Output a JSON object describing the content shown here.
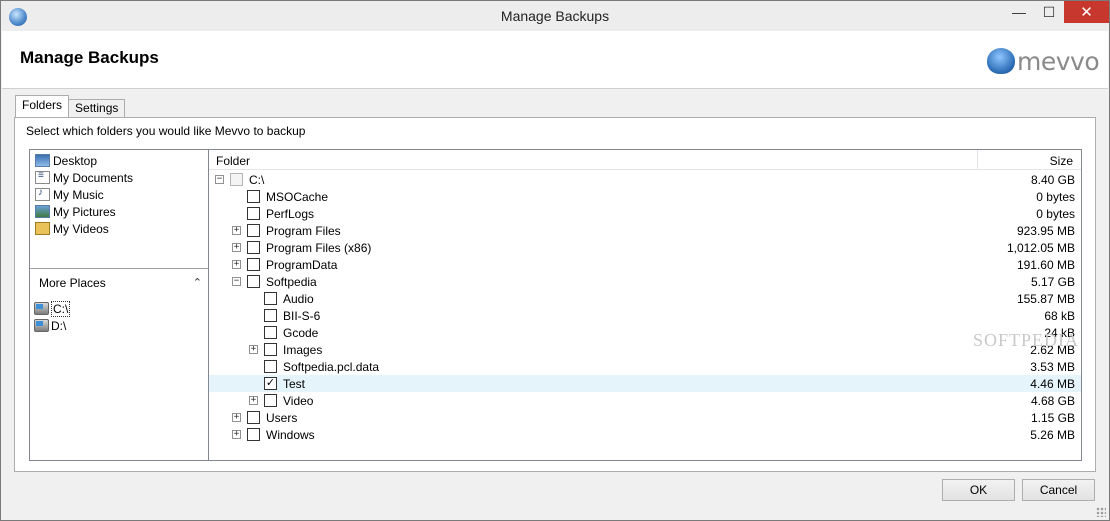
{
  "window": {
    "title": "Manage Backups",
    "minimize_glyph": "—",
    "maximize_glyph": "☐",
    "close_glyph": "✕"
  },
  "header": {
    "title": "Manage Backups",
    "logo_text": "mevvo"
  },
  "tabs": [
    {
      "label": "Folders",
      "active": true
    },
    {
      "label": "Settings",
      "active": false
    }
  ],
  "instructions": "Select which folders you would like Mevvo to backup",
  "places": [
    {
      "label": "Desktop",
      "icon": "desktop-icon"
    },
    {
      "label": "My Documents",
      "icon": "documents-icon"
    },
    {
      "label": "My Music",
      "icon": "music-icon"
    },
    {
      "label": "My Pictures",
      "icon": "pictures-icon"
    },
    {
      "label": "My Videos",
      "icon": "videos-icon"
    }
  ],
  "more_places": {
    "label": "More Places",
    "collapse_glyph": "⌃"
  },
  "drives": [
    {
      "label": "C:\\",
      "selected": true
    },
    {
      "label": "D:\\",
      "selected": false
    }
  ],
  "tree": {
    "columns": {
      "folder": "Folder",
      "size": "Size"
    },
    "rows": [
      {
        "label": "C:\\",
        "size": "8.40 GB",
        "expander": "−",
        "checked": "",
        "disabled": true,
        "highlight": false
      },
      {
        "label": "MSOCache",
        "size": "0 bytes",
        "expander": "",
        "checked": "",
        "disabled": false,
        "highlight": false
      },
      {
        "label": "PerfLogs",
        "size": "0 bytes",
        "expander": "",
        "checked": "",
        "disabled": false,
        "highlight": false
      },
      {
        "label": "Program Files",
        "size": "923.95 MB",
        "expander": "+",
        "checked": "",
        "disabled": false,
        "highlight": false
      },
      {
        "label": "Program Files (x86)",
        "size": "1,012.05 MB",
        "expander": "+",
        "checked": "",
        "disabled": false,
        "highlight": false
      },
      {
        "label": "ProgramData",
        "size": "191.60 MB",
        "expander": "+",
        "checked": "",
        "disabled": false,
        "highlight": false
      },
      {
        "label": "Softpedia",
        "size": "5.17 GB",
        "expander": "−",
        "checked": "",
        "disabled": false,
        "highlight": false
      },
      {
        "label": "Audio",
        "size": "155.87 MB",
        "expander": "",
        "checked": "",
        "disabled": false,
        "highlight": false
      },
      {
        "label": "BII-S-6",
        "size": "68 kB",
        "expander": "",
        "checked": "",
        "disabled": false,
        "highlight": false
      },
      {
        "label": "Gcode",
        "size": "24 kB",
        "expander": "",
        "checked": "",
        "disabled": false,
        "highlight": false
      },
      {
        "label": "Images",
        "size": "2.62 MB",
        "expander": "+",
        "checked": "",
        "disabled": false,
        "highlight": false
      },
      {
        "label": "Softpedia.pcl.data",
        "size": "3.53 MB",
        "expander": "",
        "checked": "",
        "disabled": false,
        "highlight": false
      },
      {
        "label": "Test",
        "size": "4.46 MB",
        "expander": "",
        "checked": "✓",
        "disabled": false,
        "highlight": true
      },
      {
        "label": "Video",
        "size": "4.68 GB",
        "expander": "+",
        "checked": "",
        "disabled": false,
        "highlight": false
      },
      {
        "label": "Users",
        "size": "1.15 GB",
        "expander": "+",
        "checked": "",
        "disabled": false,
        "highlight": false
      },
      {
        "label": "Windows",
        "size": "5.26 MB",
        "expander": "+",
        "checked": "",
        "disabled": false,
        "highlight": false
      }
    ]
  },
  "watermark": "SOFTPEDIA",
  "buttons": {
    "ok": "OK",
    "cancel": "Cancel"
  }
}
